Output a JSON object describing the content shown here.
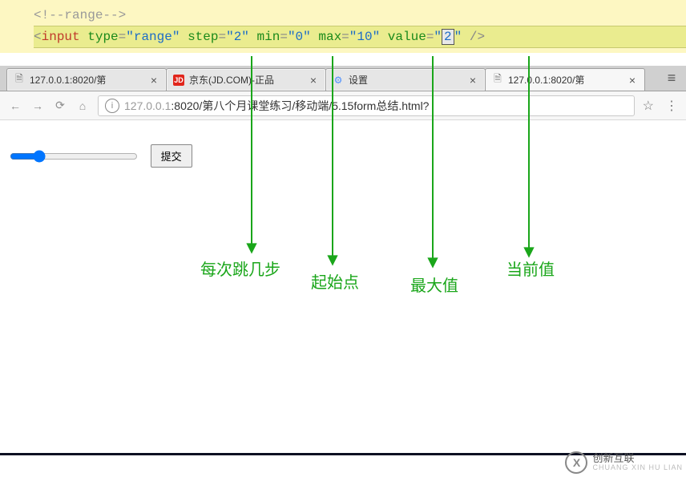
{
  "code": {
    "comment": "<!--range-->",
    "tag_open": "<",
    "tag_name": "input",
    "attr_type": "type",
    "val_type": "\"range\"",
    "attr_step": "step",
    "val_step": "\"2\"",
    "attr_min": "min",
    "val_min": "\"0\"",
    "attr_max": "max",
    "val_max": "\"10\"",
    "attr_value": "value",
    "val_value_open": "\"",
    "val_value_cursor": "2",
    "val_value_close": "\"",
    "tag_close": " />"
  },
  "tabs": [
    {
      "title": "127.0.0.1:8020/第",
      "fav": "doc",
      "active": false
    },
    {
      "title": "京东(JD.COM)-正品",
      "fav": "jd",
      "active": false
    },
    {
      "title": "设置",
      "fav": "gear",
      "active": false
    },
    {
      "title": "127.0.0.1:8020/第",
      "fav": "doc",
      "active": true
    }
  ],
  "toolbar": {
    "info_icon": "ⓘ",
    "url_gray": "127.0.0.1",
    "url_rest": ":8020/第八个月课堂练习/移动端/5.15form总结.html?"
  },
  "page": {
    "submit_label": "提交"
  },
  "annotations": {
    "step": "每次跳几步",
    "min": "起始点",
    "max": "最大值",
    "value": "当前值"
  },
  "watermark": {
    "logo": "X",
    "line1": "创新互联",
    "line2": "CHUANG XIN HU LIAN"
  }
}
